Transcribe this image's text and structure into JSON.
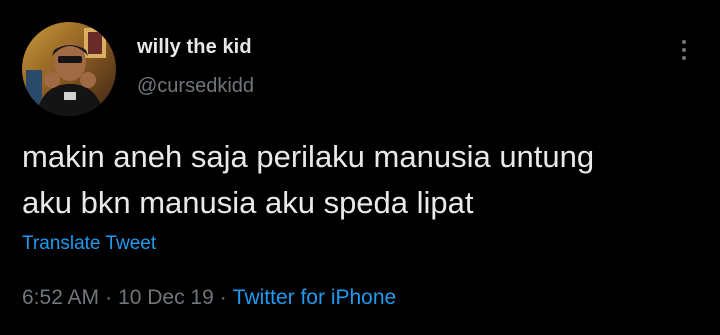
{
  "tweet": {
    "author": {
      "display_name": "willy the kid",
      "handle": "@cursedkidd"
    },
    "text_lines": [
      "makin aneh saja perilaku manusia untung",
      "aku bkn manusia aku speda lipat"
    ],
    "translate_label": "Translate Tweet",
    "time": "6:52 AM",
    "date": "10 Dec 19",
    "separator": "·",
    "source": "Twitter for iPhone"
  },
  "colors": {
    "background": "#000000",
    "primary_text": "#e7e9ea",
    "secondary_text": "#71767b",
    "link": "#1d9bf0"
  },
  "icons": {
    "more": "more-vertical-icon"
  }
}
